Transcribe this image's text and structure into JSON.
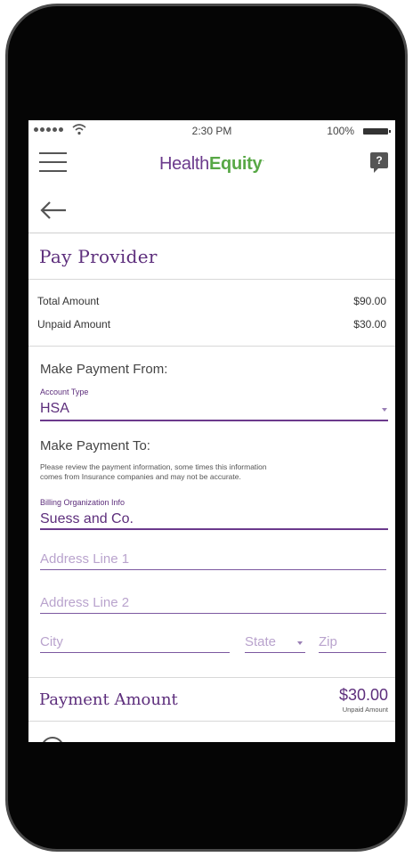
{
  "status_bar": {
    "time": "2:30 PM",
    "battery": "100%"
  },
  "header": {
    "logo_part1": "Health",
    "logo_part2": "Equity",
    "logo_tm": "·",
    "help_label": "?"
  },
  "page": {
    "title": "Pay Provider"
  },
  "amounts": [
    {
      "label": "Total Amount",
      "value": "$90.00"
    },
    {
      "label": "Unpaid Amount",
      "value": "$30.00"
    }
  ],
  "make_payment_from": {
    "title": "Make Payment From:",
    "account_type_label": "Account Type",
    "account_type_value": "HSA"
  },
  "make_payment_to": {
    "title": "Make Payment To:",
    "note_line1": "Please review the payment information, some times this information",
    "note_line2": "comes from Insurance companies and may not be accurate.",
    "billing_label": "Billing Organization Info",
    "billing_value": "Suess and Co.",
    "address1_placeholder": "Address Line 1",
    "address2_placeholder": "Address Line 2",
    "city_placeholder": "City",
    "state_placeholder": "State",
    "zip_placeholder": "Zip"
  },
  "payment_amount": {
    "label": "Payment Amount",
    "value": "$30.00",
    "sub": "Unpaid Amount"
  },
  "colors": {
    "brand_purple": "#5d2e7c",
    "brand_green": "#58a846",
    "placeholder_purple": "#b9a3cd"
  }
}
